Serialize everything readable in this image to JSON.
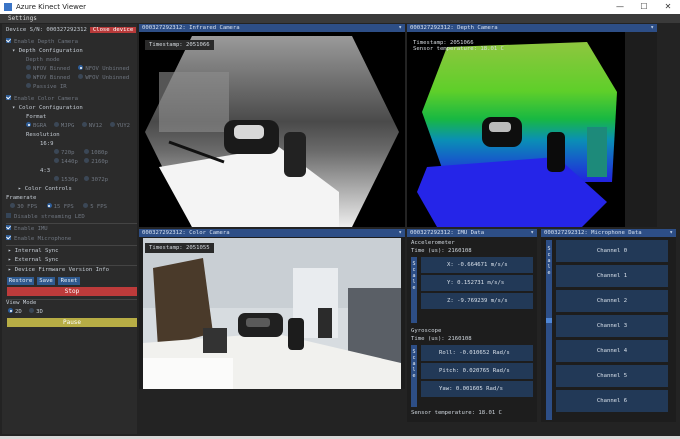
{
  "window": {
    "title": "Azure Kinect Viewer",
    "minimize": "—",
    "maximize": "☐",
    "close": "✕"
  },
  "menu": {
    "settings": "Settings"
  },
  "sidebar": {
    "device_sn": "Device S/N: 000327292312",
    "close_device": "Close device",
    "enable_depth": "Enable Depth Camera",
    "depth_config": "Depth Configuration",
    "depth_mode": "Depth mode",
    "nfov_binned": "NFOV Binned",
    "nfov_unbinned": "NFOV Unbinned",
    "wfov_binned": "WFOV Binned",
    "wfov_unbinned": "WFOV Unbinned",
    "passive_ir": "Passive IR",
    "enable_color": "Enable Color Camera",
    "color_config": "Color Configuration",
    "format": "Format",
    "bgra": "BGRA",
    "mjpg": "MJPG",
    "nv12": "NV12",
    "yuy2": "YUY2",
    "resolution": "Resolution",
    "r169": "16:9",
    "r720": "720p",
    "r1080": "1080p",
    "r1440": "1440p",
    "r2160": "2160p",
    "r43": "4:3",
    "r1536": "1536p",
    "r3072": "3072p",
    "color_controls": "Color Controls",
    "framerate": "Framerate",
    "fps30": "30 FPS",
    "fps15": "15 FPS",
    "fps5": "5 FPS",
    "disable_led": "Disable streaming LED",
    "enable_imu": "Enable IMU",
    "enable_mic": "Enable Microphone",
    "internal_sync": "Internal Sync",
    "external_sync": "External Sync",
    "firmware": "Device Firmware Version Info",
    "restore": "Restore",
    "save": "Save",
    "reset": "Reset",
    "stop": "Stop",
    "view_mode": "View Mode",
    "v2d": "2D",
    "v3d": "3D",
    "pause": "Pause"
  },
  "panels": {
    "ir": {
      "title": "000327292312: Infrared Camera",
      "timestamp": "Timestamp: 2051066"
    },
    "depth": {
      "title": "000327292312: Depth Camera",
      "timestamp": "Timestamp: 2051066",
      "sensor": "Sensor temperature: 18.01 C"
    },
    "color": {
      "title": "000327292312: Color Camera",
      "timestamp": "Timestamp: 2051055"
    },
    "imu": {
      "title": "000327292312: IMU Data",
      "accel": "Accelerometer",
      "accel_time": "Time (us): 2160108",
      "ax": "X:   -0.664671 m/s/s",
      "ay": "Y:    0.152731 m/s/s",
      "az": "Z:   -9.769239 m/s/s",
      "gyro": "Gyroscope",
      "gyro_time": "Time (us): 2160108",
      "roll": "Roll:   -0.010652 Rad/s",
      "pitch": "Pitch:    0.020765 Rad/s",
      "yaw": "Yaw:    0.001605 Rad/s",
      "sensor": "Sensor temperature: 18.01 C",
      "scale": "Scale"
    },
    "mic": {
      "title": "000327292312: Microphone Data",
      "scale": "Scale",
      "channels": [
        "Channel 0",
        "Channel 1",
        "Channel 2",
        "Channel 3",
        "Channel 4",
        "Channel 5",
        "Channel 6"
      ]
    }
  }
}
